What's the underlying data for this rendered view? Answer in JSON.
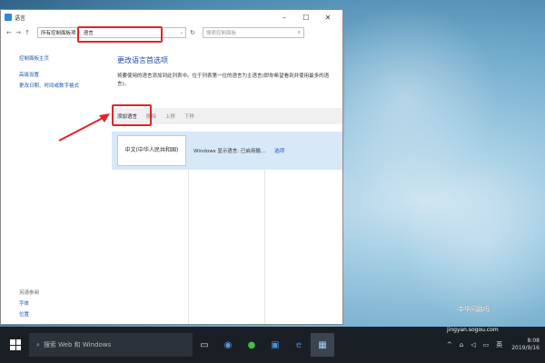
{
  "window": {
    "title": "语言",
    "controls": {
      "minimize": "–",
      "maximize": "☐",
      "close": "✕"
    }
  },
  "nav": {
    "back": "←",
    "forward": "→",
    "up": "↑"
  },
  "address": {
    "segments": [
      "所有控制面板项",
      "语言"
    ],
    "separator": "›",
    "dropdown": "⌄",
    "refresh": "↻"
  },
  "search": {
    "placeholder": "搜索控制面板",
    "icon": "⌕"
  },
  "sidebar": {
    "items": [
      "控制面板主页",
      "高级设置",
      "更改日期、时间或数字格式"
    ]
  },
  "see_also": {
    "heading": "另请参阅",
    "items": [
      "字体",
      "位置"
    ]
  },
  "main": {
    "heading": "更改语言首选项",
    "description": "将要使用的语言添加到此列表中。位于列表第一位的语言为主语言(即你希望看到并使用最多的语言)。"
  },
  "toolbar": {
    "add": "添加语言",
    "remove": "删除",
    "up": "上移",
    "down": "下移"
  },
  "languages": [
    {
      "name": "中文(中华人民共和国)",
      "status": "Windows 显示语言: 已启用输...",
      "options": "选项"
    }
  ],
  "taskbar": {
    "search_placeholder": "搜索 Web 和 Windows",
    "apps": [
      "task-view",
      "browser",
      "wechat",
      "store",
      "edge",
      "control-panel"
    ],
    "tray": {
      "chevron": "^",
      "network": "⌂",
      "volume": "◁",
      "notification": "▭",
      "ime": "英",
      "time": "8:08",
      "date": "2019/9/16"
    }
  },
  "watermark": {
    "text": "中华问路吗",
    "url": "jingyan.sogou.com"
  },
  "colors": {
    "highlight": "#e0242a",
    "link": "#1a56b0",
    "selected_row": "#d7e8f8"
  }
}
